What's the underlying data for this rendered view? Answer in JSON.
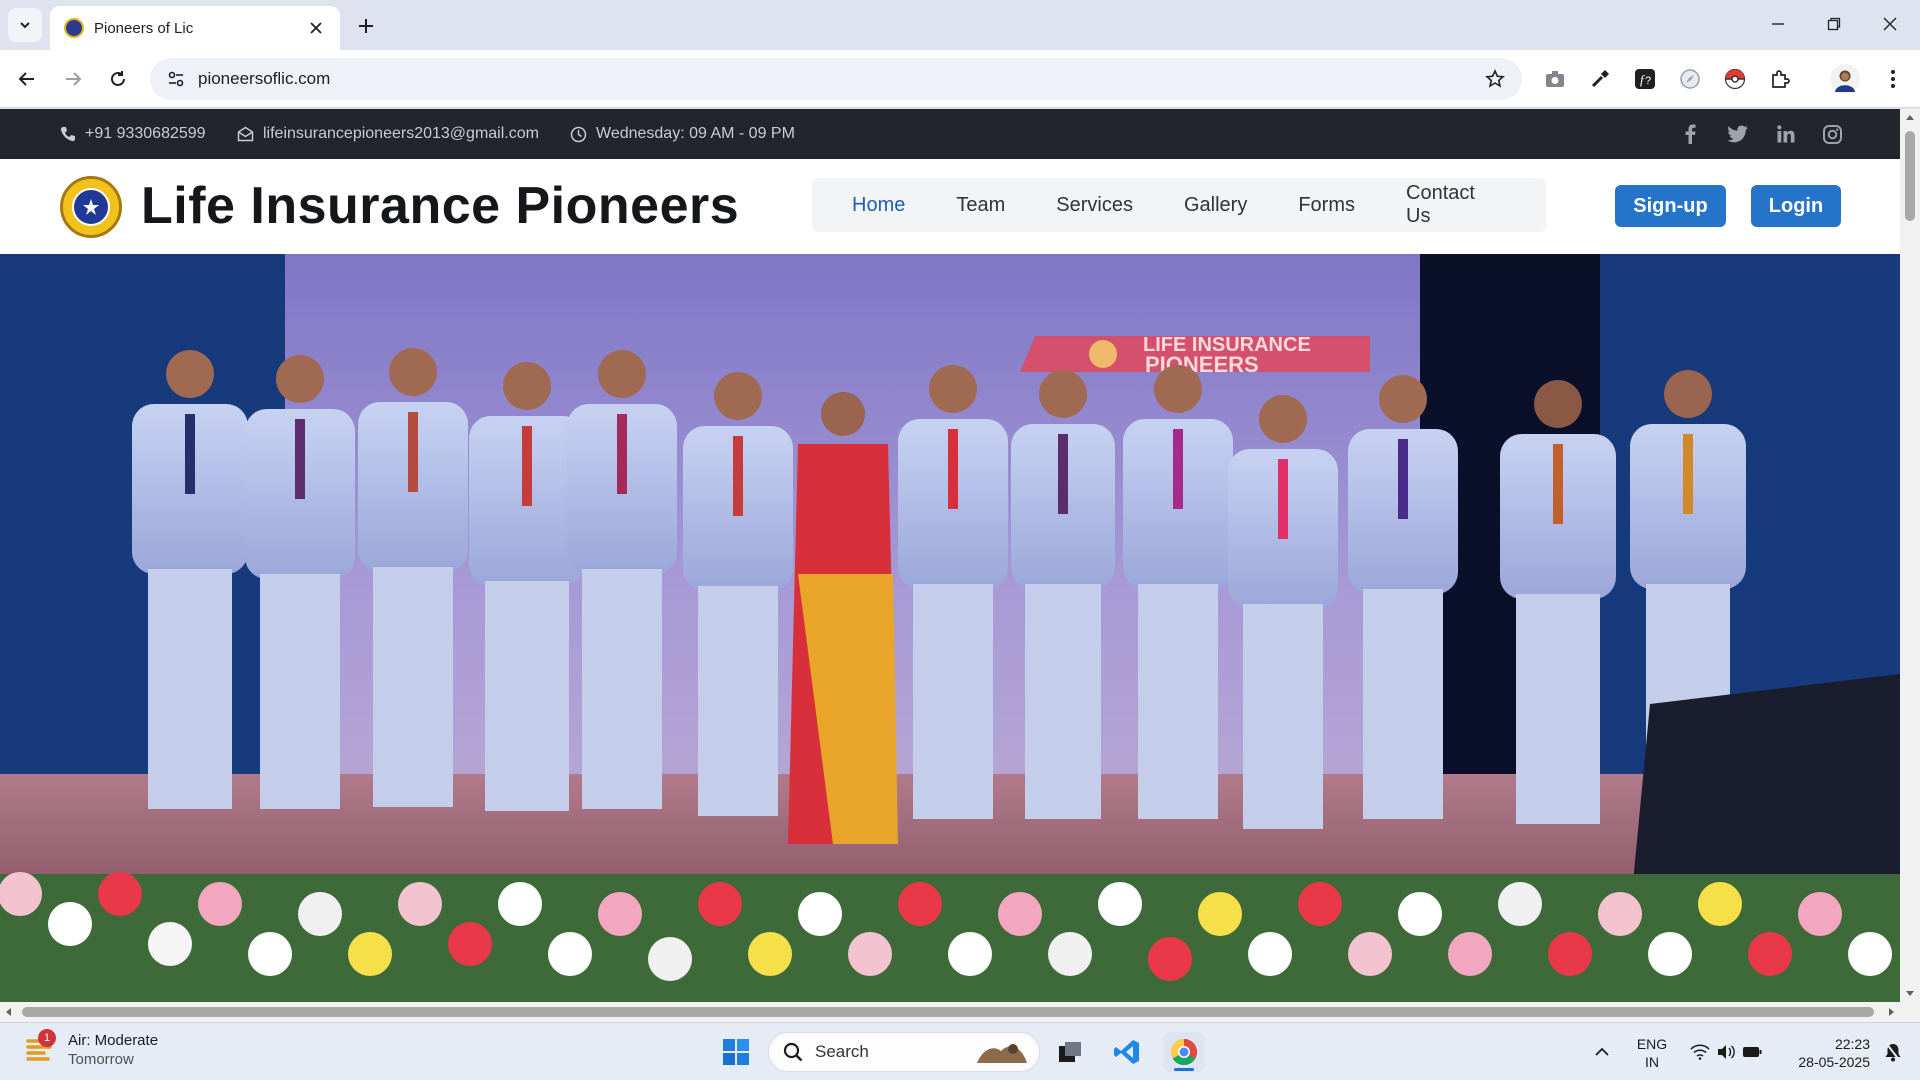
{
  "browser": {
    "tab_title": "Pioneers of Lic",
    "url": "pioneersoflic.com"
  },
  "site": {
    "topbar": {
      "phone": "+91 9330682599",
      "email": "lifeinsurancepioneers2013@gmail.com",
      "hours": "Wednesday: 09 AM - 09 PM",
      "socials": [
        "facebook-icon",
        "twitter-icon",
        "linkedin-icon",
        "instagram-icon"
      ]
    },
    "title": "Life Insurance Pioneers",
    "menu": [
      "Home",
      "Team",
      "Services",
      "Gallery",
      "Forms",
      "Contact Us"
    ],
    "active_menu": "Home",
    "signup_label": "Sign-up",
    "login_label": "Login",
    "hero": {
      "banner_line1": "LIFE INSURANCE",
      "banner_line2": "PIONEERS"
    }
  },
  "taskbar": {
    "weather_badge": "1",
    "weather_title": "Air: Moderate",
    "weather_sub": "Tomorrow",
    "search_placeholder": "Search",
    "lang_top": "ENG",
    "lang_bottom": "IN",
    "time": "22:23",
    "date": "28-05-2025"
  },
  "colors": {
    "accent": "#2574c9",
    "active_menu": "#1a5fb4",
    "topbar_bg": "#22252b"
  }
}
